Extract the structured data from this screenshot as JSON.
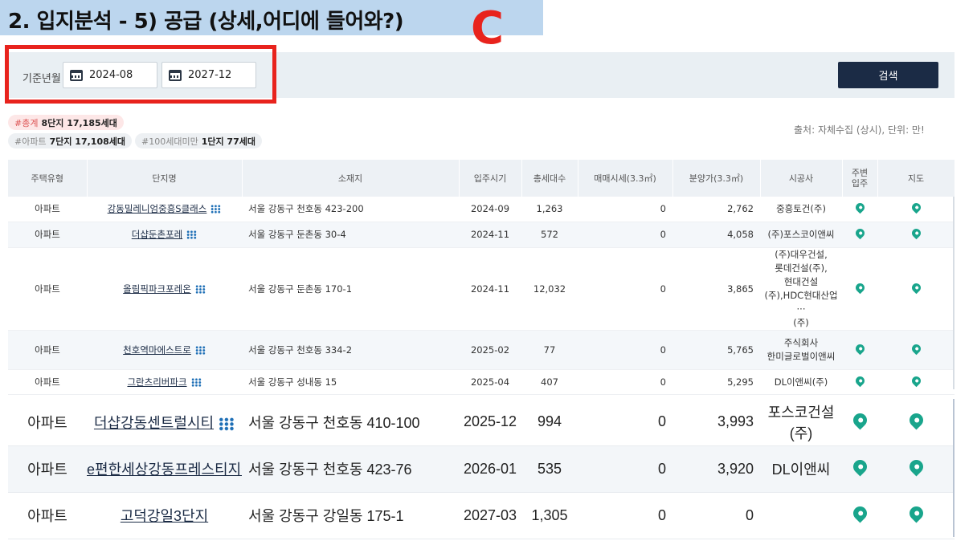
{
  "slide": {
    "title": "2. 입지분석 - 5) 공급 (상세,어디에 들어와?)",
    "mark": "C"
  },
  "filter": {
    "base_label": "기준년월",
    "from_date": "2024-08",
    "to_date": "2027-12",
    "search_label": "검색"
  },
  "summary": {
    "total_tag": "#총계",
    "total_value": "8단지 17,185세대",
    "apt_tag": "#아파트",
    "apt_value": "7단지 17,108세대",
    "small_tag": "#100세대미만",
    "small_value": "1단지 77세대",
    "source": "출처: 자체수집 (상시), 단위: 만!"
  },
  "columns": [
    "주택유형",
    "단지명",
    "소재지",
    "입주시기",
    "총세대수",
    "매매시세(3.3㎡)",
    "분양가(3.3㎡)",
    "시공사",
    "주변\n입주",
    "지도"
  ],
  "rows": [
    {
      "type": "아파트",
      "name": "강동밀레니엄중흥S클래스",
      "addr": "서울 강동구 천호동 423-200",
      "date": "2024-09",
      "units": "1,263",
      "sale": "0",
      "price": "2,762",
      "builder": "중흥토건(주)"
    },
    {
      "type": "아파트",
      "name": "더샵둔촌포레",
      "addr": "서울 강동구 둔촌동 30-4",
      "date": "2024-11",
      "units": "572",
      "sale": "0",
      "price": "4,058",
      "builder": "(주)포스코이앤씨"
    },
    {
      "type": "아파트",
      "name": "올림픽파크포레온",
      "addr": "서울 강동구 둔촌동 170-1",
      "date": "2024-11",
      "units": "12,032",
      "sale": "0",
      "price": "3,865",
      "builder": "(주)대우건설,\n롯데건설(주),\n현대건설\n(주),HDC현대산업···\n(주)"
    },
    {
      "type": "아파트",
      "name": "천호역마에스트로",
      "addr": "서울 강동구 천호동 334-2",
      "date": "2025-02",
      "units": "77",
      "sale": "0",
      "price": "5,765",
      "builder": "주식회사\n한미글로벌이앤씨"
    },
    {
      "type": "아파트",
      "name": "그란츠리버파크",
      "addr": "서울 강동구 성내동 15",
      "date": "2025-04",
      "units": "407",
      "sale": "0",
      "price": "5,295",
      "builder": "DL이앤씨(주)"
    }
  ],
  "rows_zoomed": [
    {
      "type": "아파트",
      "name": "더샵강동센트럴시티",
      "addr": "서울 강동구 천호동 410-100",
      "date": "2025-12",
      "units": "994",
      "sale": "0",
      "price": "3,993",
      "builder": "포스코건설(주)"
    },
    {
      "type": "아파트",
      "name": "e편한세상강동프레스티지원",
      "addr": "서울 강동구 천호동 423-76",
      "date": "2026-01",
      "units": "535",
      "sale": "0",
      "price": "3,920",
      "builder": "DL이앤씨"
    },
    {
      "type": "아파트",
      "name": "고덕강일3단지",
      "addr": "서울 강동구 강일동 175-1",
      "date": "2027-03",
      "units": "1,305",
      "sale": "0",
      "price": "0",
      "builder": ""
    }
  ],
  "colors": {
    "title_band": "#bcd6ee",
    "highlight_red": "#e8231d",
    "search_button": "#1b2b45",
    "map_pin": "#19a58c",
    "grid_icon": "#1e6fb6"
  },
  "icons": {
    "calendar": "calendar-icon",
    "complex_detail": "grid-dots-icon",
    "map": "map-pin-icon"
  }
}
